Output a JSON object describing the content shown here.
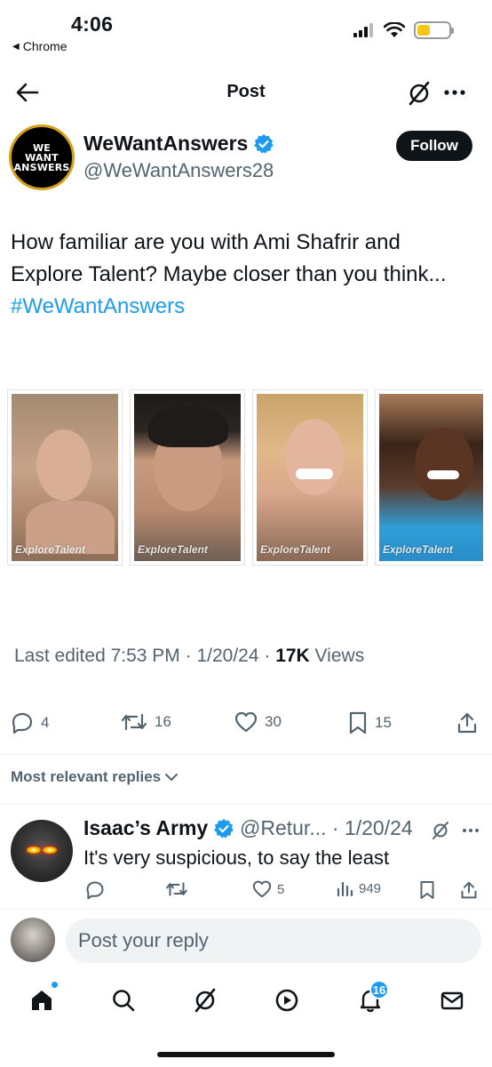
{
  "status_bar": {
    "time": "4:06",
    "back_app": "Chrome",
    "battery_level": 0.4,
    "battery_color": "#f5c518"
  },
  "header": {
    "back_icon": "arrow-left-icon",
    "title": "Post",
    "grok_icon": "grok-icon",
    "more_icon": "more-icon"
  },
  "author": {
    "avatar_lines": [
      "WE",
      "WANT",
      "ANSWERS"
    ],
    "name": "WeWantAnswers",
    "verified": true,
    "handle": "@WeWantAnswers28",
    "follow_label": "Follow"
  },
  "tweet": {
    "text": "How familiar are you with Ami Shafrir and Explore Talent? Maybe closer than you think... ",
    "hashtag": "#WeWantAnswers",
    "images": [
      {
        "watermark": "ExploreTalent"
      },
      {
        "watermark": "ExploreTalent"
      },
      {
        "watermark": "ExploreTalent"
      },
      {
        "watermark": "ExploreTalent"
      }
    ],
    "meta_prefix": "Last edited 7:53 PM · 1/20/24  · ",
    "views_count": "17K",
    "views_label": " Views"
  },
  "actions": {
    "replies": "4",
    "reposts": "16",
    "likes": "30",
    "bookmarks": "15"
  },
  "replies_sort": "Most relevant replies",
  "reply": {
    "name": "Isaac’s Army",
    "handle_date": "@Retur... · 1/20/24",
    "text": "It's very suspicious, to say the least",
    "likes": "5",
    "views": "949"
  },
  "compose": {
    "placeholder": "Post your reply"
  },
  "nav": {
    "notifications_badge": "16",
    "accent": "#1d9bf0"
  }
}
